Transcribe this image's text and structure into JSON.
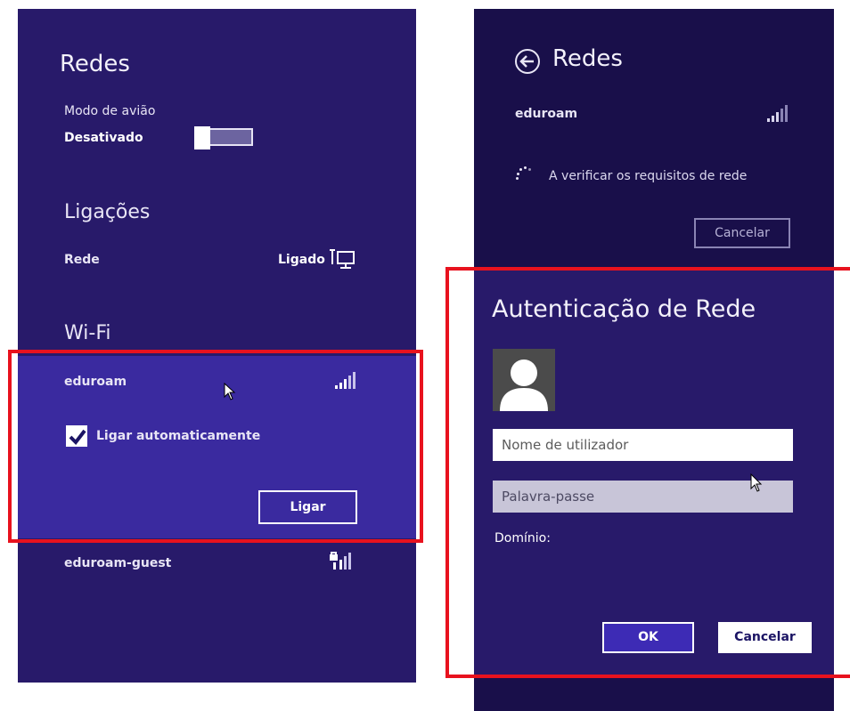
{
  "left_panel": {
    "title": "Redes",
    "airplane_label": "Modo de avião",
    "airplane_state": "Desativado",
    "connections_heading": "Ligações",
    "network_label": "Rede",
    "network_state": "Ligado",
    "wifi_heading": "Wi-Fi",
    "selected_network": "eduroam",
    "auto_connect_label": "Ligar automaticamente",
    "auto_connect_checked": true,
    "connect_button": "Ligar",
    "other_network": "eduroam-guest"
  },
  "right_top": {
    "title": "Redes",
    "network_name": "eduroam",
    "status_text": "A verificar os requisitos de rede",
    "cancel_button": "Cancelar"
  },
  "auth_dialog": {
    "title": "Autenticação de Rede",
    "username_placeholder": "Nome de utilizador",
    "password_placeholder": "Palavra-passe",
    "domain_label": "Domínio:",
    "ok_button": "OK",
    "cancel_button": "Cancelar"
  },
  "colors": {
    "panel_background": "#281a6a",
    "panel_dark": "#190f4a",
    "selected_item": "#3a2a9f",
    "highlight_frame": "#e8121e"
  },
  "icons": {
    "ethernet": "ethernet-icon",
    "wifi_signal": "wifi-signal-icon",
    "secured_wifi": "wifi-secured-icon",
    "back": "back-arrow-icon",
    "spinner": "loading-spinner-icon",
    "user": "user-avatar-icon",
    "cursor": "mouse-pointer-icon"
  }
}
